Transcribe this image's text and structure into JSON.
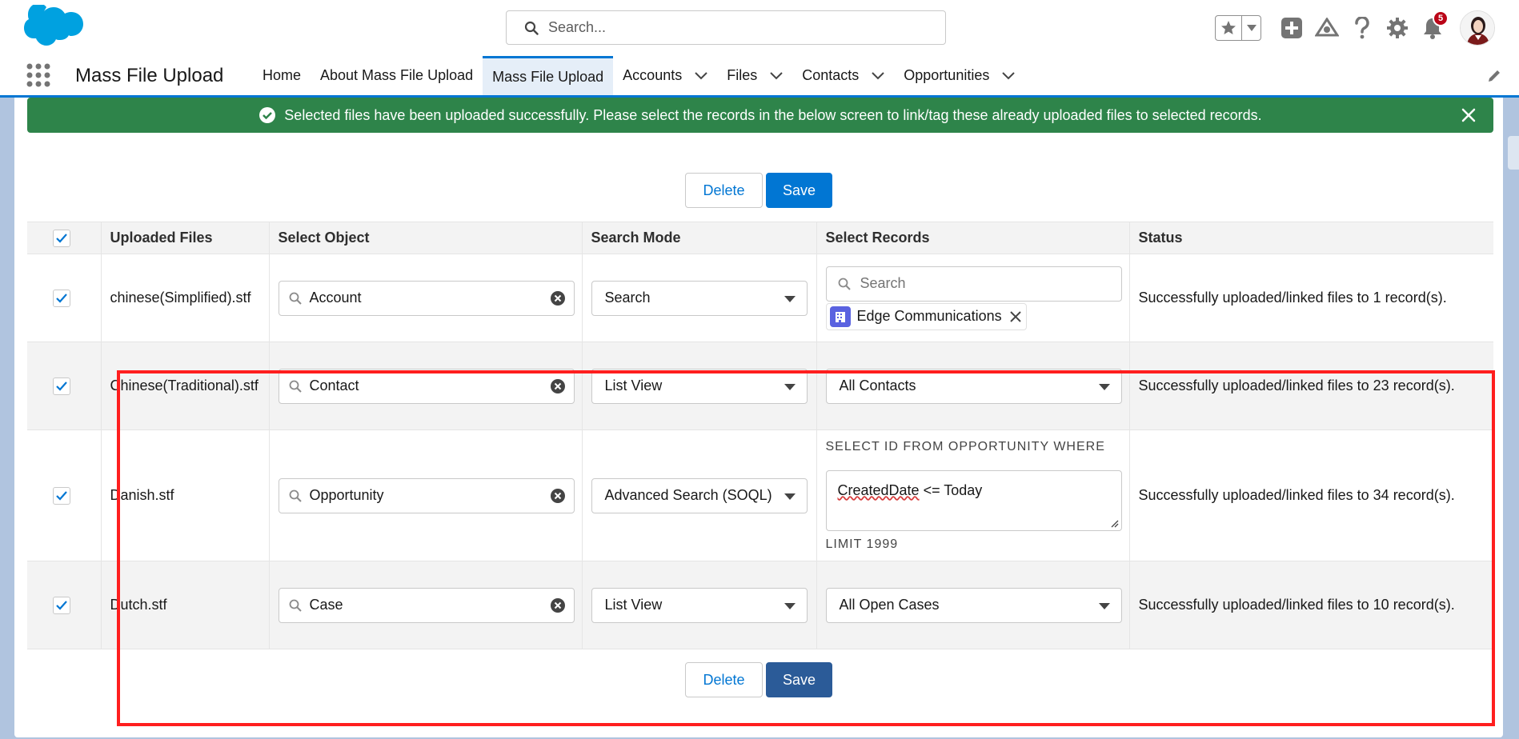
{
  "header": {
    "search_placeholder": "Search...",
    "notification_count": "5"
  },
  "nav": {
    "app_name": "Mass File Upload",
    "tabs": [
      {
        "label": "Home",
        "has_menu": false
      },
      {
        "label": "About Mass File Upload",
        "has_menu": false
      },
      {
        "label": "Mass File Upload",
        "has_menu": false,
        "active": true
      },
      {
        "label": "Accounts",
        "has_menu": true
      },
      {
        "label": "Files",
        "has_menu": true
      },
      {
        "label": "Contacts",
        "has_menu": true
      },
      {
        "label": "Opportunities",
        "has_menu": true
      }
    ]
  },
  "toast": {
    "message": "Selected files have been uploaded successfully. Please select the records in the below screen to link/tag these already uploaded files to selected records."
  },
  "buttons": {
    "delete": "Delete",
    "save": "Save"
  },
  "table": {
    "headers": [
      "Uploaded Files",
      "Select Object",
      "Search Mode",
      "Select Records",
      "Status"
    ],
    "rows": [
      {
        "file": "chinese(Simplified).stf",
        "object": "Account",
        "mode": "Search",
        "records_search_placeholder": "Search",
        "records_pill": "Edge Communications",
        "status": "Successfully uploaded/linked files to 1 record(s)."
      },
      {
        "file": "Chinese(Traditional).stf",
        "object": "Contact",
        "mode": "List View",
        "records_view": "All Contacts",
        "status": "Successfully uploaded/linked files to 23 record(s)."
      },
      {
        "file": "Danish.stf",
        "object": "Opportunity",
        "mode": "Advanced Search (SOQL)",
        "soql_prefix": "SELECT ID FROM OPPORTUNITY WHERE",
        "soql_word": "CreatedDate",
        "soql_rest": " <= Today",
        "soql_suffix": "LIMIT 1999",
        "status": "Successfully uploaded/linked files to 34 record(s)."
      },
      {
        "file": "Dutch.stf",
        "object": "Case",
        "mode": "List View",
        "records_view": "All Open Cases",
        "status": "Successfully uploaded/linked files to 10 record(s)."
      }
    ]
  },
  "colors": {
    "brand": "#0176d3",
    "success": "#2e844a",
    "highlight": "#ff1e1e"
  }
}
